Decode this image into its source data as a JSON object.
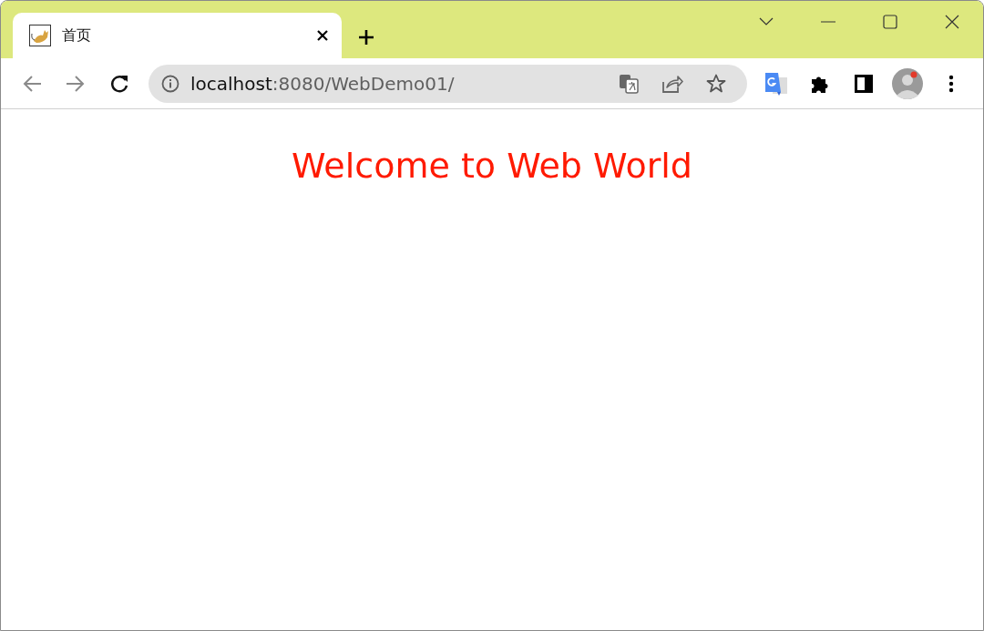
{
  "tabs": [
    {
      "title": "首页",
      "selected": true
    }
  ],
  "address_bar": {
    "host": "localhost",
    "path": ":8080/WebDemo01/"
  },
  "page": {
    "heading": "Welcome to Web World"
  }
}
